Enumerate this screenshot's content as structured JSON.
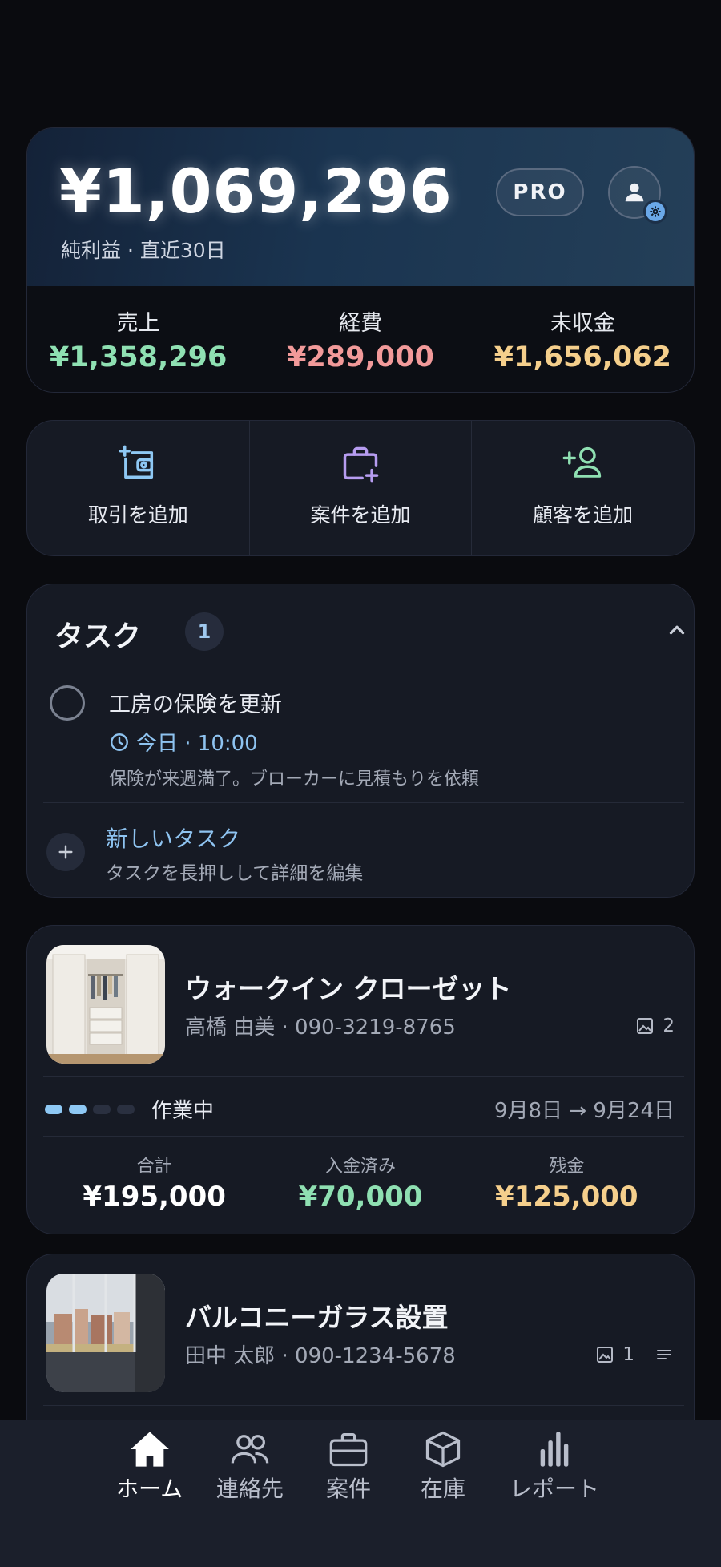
{
  "summary": {
    "net_profit": "¥1,069,296",
    "net_label": "純利益 · 直近30日",
    "plan_badge": "PRO",
    "stats": [
      {
        "label": "売上",
        "value": "¥1,358,296",
        "color": "#8fe0b2"
      },
      {
        "label": "経費",
        "value": "¥289,000",
        "color": "#f29a9a"
      },
      {
        "label": "未収金",
        "value": "¥1,656,062",
        "color": "#f5cf8c"
      }
    ]
  },
  "actions": [
    {
      "label": "取引を追加",
      "icon": "add-transaction-icon",
      "color": "#8ec8f4"
    },
    {
      "label": "案件を追加",
      "icon": "add-project-icon",
      "color": "#b69cf0"
    },
    {
      "label": "顧客を追加",
      "icon": "add-customer-icon",
      "color": "#8fe0b2"
    }
  ],
  "tasks": {
    "title": "タスク",
    "count": "1",
    "items": [
      {
        "title": "工房の保険を更新",
        "time": "今日 · 10:00",
        "note": "保険が来週満了。ブローカーに見積もりを依頼"
      }
    ],
    "new_title": "新しいタスク",
    "new_sub": "タスクを長押しして詳細を編集"
  },
  "projects": [
    {
      "title": "ウォークイン クローゼット",
      "customer": "高橋 由美 · 090-3219-8765",
      "photos": "2",
      "status": "作業中",
      "progress": 0.5,
      "dates": "9月8日 → 9月24日",
      "amounts": [
        {
          "label": "合計",
          "value": "¥195,000",
          "color": "#ffffff"
        },
        {
          "label": "入金済み",
          "value": "¥70,000",
          "color": "#8fe0b2"
        },
        {
          "label": "残金",
          "value": "¥125,000",
          "color": "#f5cf8c"
        }
      ]
    },
    {
      "title": "バルコニーガラス設置",
      "customer": "田中 太郎 · 090-1234-5678",
      "photos": "1"
    }
  ],
  "nav": [
    {
      "label": "ホーム",
      "icon": "home-icon",
      "active": true
    },
    {
      "label": "連絡先",
      "icon": "contacts-icon",
      "active": false
    },
    {
      "label": "案件",
      "icon": "briefcase-icon",
      "active": false
    },
    {
      "label": "在庫",
      "icon": "box-icon",
      "active": false
    },
    {
      "label": "レポート",
      "icon": "chart-icon",
      "active": false
    }
  ]
}
